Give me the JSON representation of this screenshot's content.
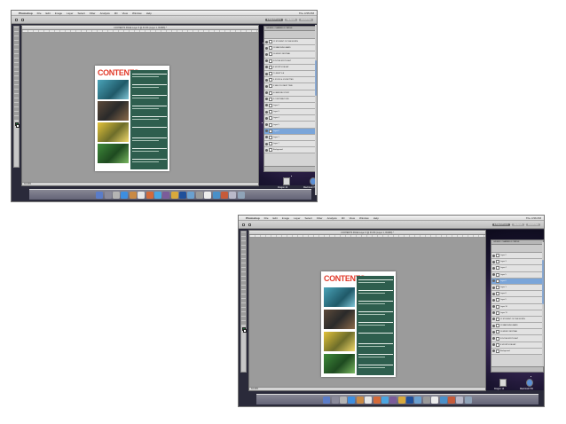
{
  "screenshots": [
    {
      "menubar": {
        "app_name": "Photoshop",
        "menus": [
          "File",
          "Edit",
          "Image",
          "Layer",
          "Select",
          "Filter",
          "Analysis",
          "3D",
          "View",
          "Window",
          "Help"
        ],
        "clock": "Thu 4:55 PM"
      },
      "options_bar": {
        "workspaces": [
          "ESSENTIALS",
          "DESIGN",
          "PAINTING"
        ],
        "active_workspace": "ESSENTIALS"
      },
      "document": {
        "tab_title": "CONTENTS PAGE Layer 6 @ 33.3% (Layer 1, RGB/8) *",
        "status": "33.33%",
        "page_title": "CONTENTS"
      },
      "layers_panel": {
        "tabs": [
          "LAYERS",
          "CHANNELS",
          "PATHS"
        ],
        "rows": [
          "12 STUDENT OF THE MONTH",
          "11 MARCHING BAND",
          "10 MUSIC FESTIVAL",
          "9 IN THE SPOTLIGHT",
          "8 SPORTS RECAP",
          "7 LIFESTYLE",
          "6 JOCKS & JOCKETTES",
          "5 SEE YOU NEXT TIME",
          "4 FEATURE STORY",
          "3 CONTRIBUTORS",
          "Layer 2",
          "Layer 3",
          "Layer 4",
          "Layer 5",
          "Layer 6",
          "Layer 1",
          "Layer 7",
          "Background"
        ],
        "selected_index": 14
      },
      "desktop_icons": [
        {
          "label": "Dragon 14"
        },
        {
          "label": "Macintosh HD"
        }
      ]
    },
    {
      "menubar": {
        "app_name": "Photoshop",
        "menus": [
          "File",
          "Edit",
          "Image",
          "Layer",
          "Select",
          "Filter",
          "Analysis",
          "3D",
          "View",
          "Window",
          "Help"
        ],
        "clock": "Thu 4:56 PM"
      },
      "options_bar": {
        "workspaces": [
          "ESSENTIALS",
          "DESIGN",
          "PAINTING"
        ],
        "active_workspace": "ESSENTIALS"
      },
      "document": {
        "tab_title": "CONTENTS PAGE Layer 6 @ 33.3% (Layer 1, RGB/8) *",
        "status": "33.33%",
        "page_title": "CONTENTS"
      },
      "layers_panel": {
        "tabs": [
          "LAYERS",
          "CHANNELS",
          "PATHS"
        ],
        "rows": [
          "Layer 2",
          "Layer 3",
          "Layer 4",
          "Layer 5",
          "Layer 6",
          "Layer 1",
          "Layer 8",
          "Layer 9",
          "Layer 10",
          "Layer 11",
          "12 STUDENT OF THE MONTH",
          "11 MARCHING BAND",
          "10 MUSIC FESTIVAL",
          "9 IN THE SPOTLIGHT",
          "8 SPORTS RECAP",
          "Background"
        ],
        "selected_index": 4
      },
      "desktop_icons": [
        {
          "label": "Dragon 14"
        },
        {
          "label": "Macintosh HD"
        }
      ]
    }
  ],
  "colors": {
    "contents_red": "#e13a2a",
    "panel_green": "#2e5e4e",
    "selection_blue": "#7aa5d9"
  }
}
